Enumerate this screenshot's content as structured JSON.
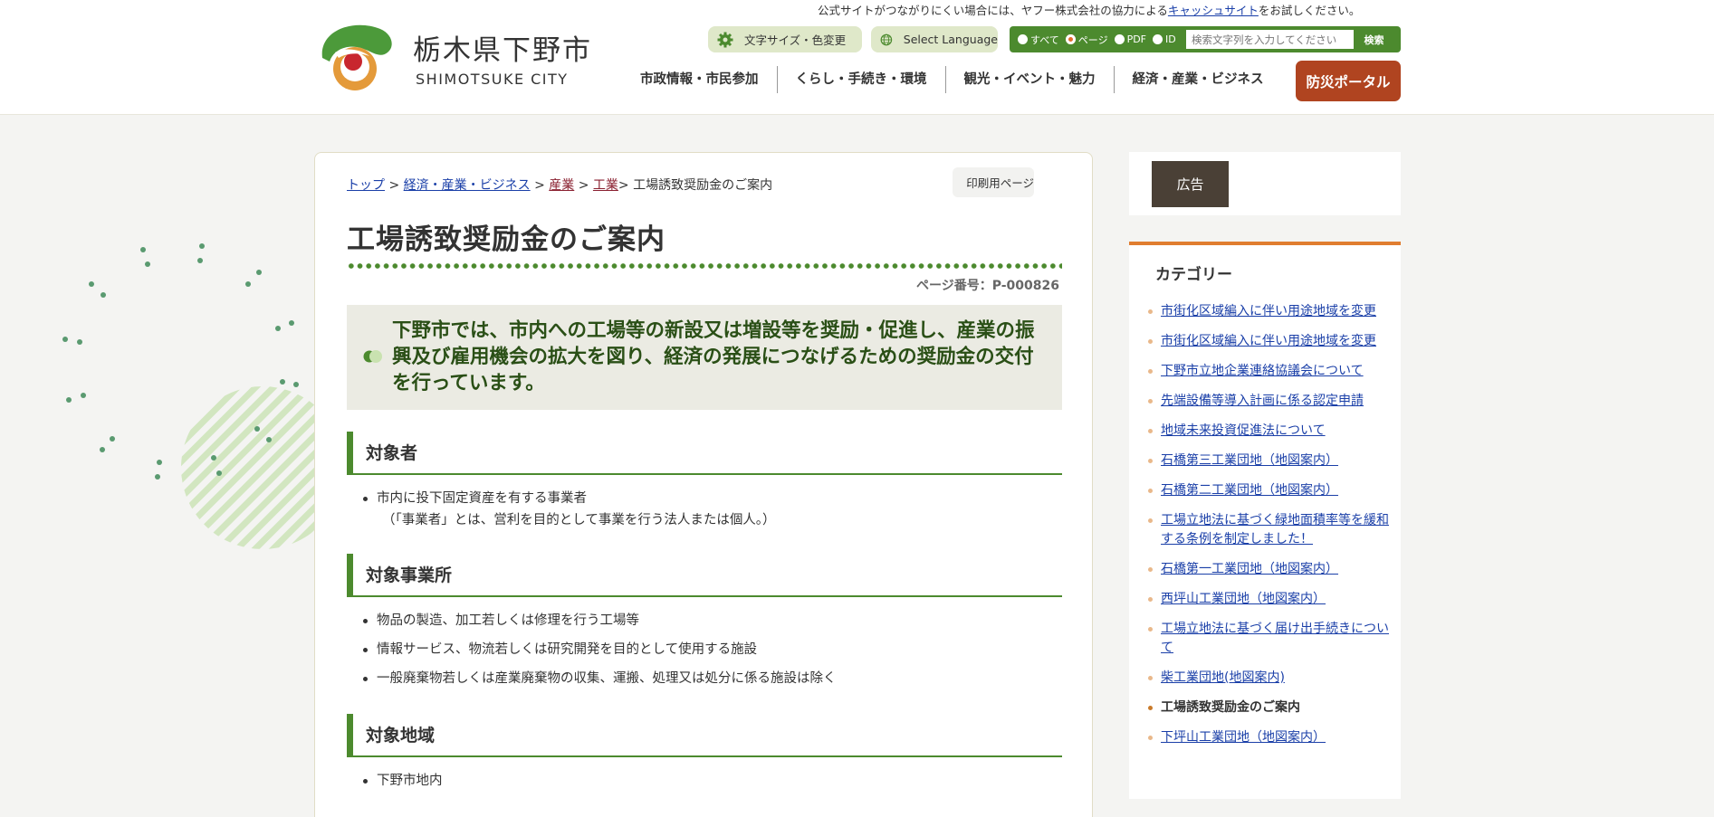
{
  "header": {
    "notice_prefix": "公式サイトがつながりにくい場合には、ヤフー株式会社の協力による",
    "notice_link": "キャッシュサイト",
    "notice_suffix": "をお試しください。",
    "logo_jp": "栃木県下野市",
    "logo_en": "SHIMOTSUKE CITY",
    "font_size_button": "文字サイズ・色変更",
    "language_button": "Select Language",
    "search": {
      "options": [
        "すべて",
        "ページ",
        "PDF",
        "ID"
      ],
      "selected": "ページ",
      "placeholder": "検索文字列を入力してください",
      "button": "検索"
    },
    "nav": [
      "市政情報・市民参加",
      "くらし・手続き・環境",
      "観光・イベント・魅力",
      "経済・産業・ビジネス"
    ],
    "bousai_button": "防災ポータル"
  },
  "breadcrumb": {
    "items": [
      "トップ",
      "経済・産業・ビジネス",
      "産業",
      "工業"
    ],
    "current": "> 工場誘致奨励金のご案内"
  },
  "print_button": "印刷用ページ",
  "page_title": "工場誘致奨励金のご案内",
  "page_number": "ページ番号：P-000826",
  "lead": "下野市では、市内への工場等の新設又は増設等を奨励・促進し、産業の振興及び雇用機会の拡大を図り、経済の発展につなげるための奨励金の交付を行っています。",
  "sections": [
    {
      "heading": "対象者",
      "items": [
        "市内に投下固定資産を有する事業者"
      ],
      "item_sub": "（「事業者」とは、営利を目的として事業を行う法人または個人。）"
    },
    {
      "heading": "対象事業所",
      "items": [
        "物品の製造、加工若しくは修理を行う工場等",
        "情報サービス、物流若しくは研究開発を目的として使用する施設",
        "一般廃棄物若しくは産業廃棄物の収集、運搬、処理又は処分に係る施設は除く"
      ]
    },
    {
      "heading": "対象地域",
      "items": [
        "下野市地内"
      ]
    }
  ],
  "sidebar": {
    "ad_button": "広告",
    "category_title": "カテゴリー",
    "categories": [
      "市街化区域編入に伴い用途地域を変更",
      "市街化区域編入に伴い用途地域を変更",
      "下野市立地企業連絡協議会について",
      "先端設備等導入計画に係る認定申請",
      "地域未来投資促進法について",
      "石橋第三工業団地（地図案内）",
      "石橋第二工業団地（地図案内）",
      "工場立地法に基づく緑地面積率等を緩和する条例を制定しました！",
      "石橋第一工業団地（地図案内）",
      "西坪山工業団地（地図案内）",
      "工場立地法に基づく届け出手続きについて",
      "柴工業団地(地図案内)",
      "工場誘致奨励金のご案内",
      "下坪山工業団地（地図案内）"
    ],
    "current_index": 12
  },
  "colors": {
    "brand_green": "#4c8a2e",
    "bousai_red": "#b04420",
    "category_orange": "#e07d30",
    "lead_bg": "#ebebe3"
  }
}
